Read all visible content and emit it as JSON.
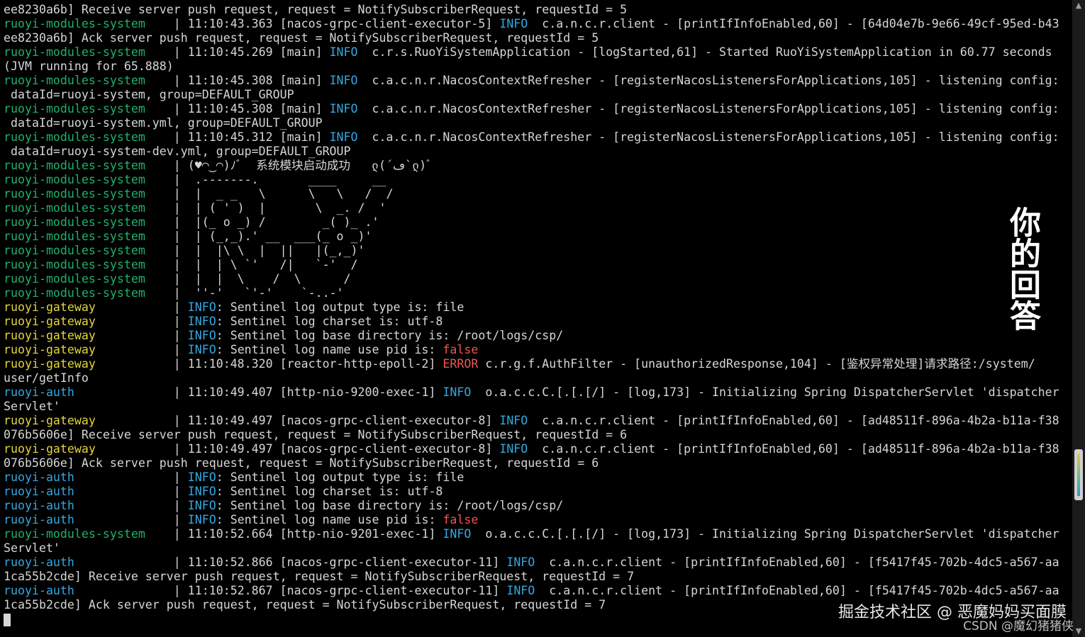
{
  "colors": {
    "background": "#000000",
    "text": "#d6d6d6",
    "service_system": "#1db36a",
    "service_gateway": "#e3d53a",
    "service_auth": "#35a7e0",
    "level_info": "#35a7e0",
    "level_error": "#f05454",
    "keyword_false": "#f05454"
  },
  "terminal": {
    "lines": [
      [
        {
          "t": "ee8230a6b] Receive server push request, request = NotifySubscriberRequest, requestId = 5",
          "c": ""
        }
      ],
      [
        {
          "t": "ruoyi-modules-system",
          "c": "svc-system"
        },
        {
          "t": "    | 11:10:43.363 [nacos-grpc-client-executor-5] ",
          "c": ""
        },
        {
          "t": "INFO",
          "c": "lvl-info"
        },
        {
          "t": "  c.a.n.c.r.client - [printIfInfoEnabled,60] - [64d04e7b-9e66-49cf-95ed-b43",
          "c": ""
        }
      ],
      [
        {
          "t": "ee8230a6b] Ack server push request, request = NotifySubscriberRequest, requestId = 5",
          "c": ""
        }
      ],
      [
        {
          "t": "ruoyi-modules-system",
          "c": "svc-system"
        },
        {
          "t": "    | 11:10:45.269 [main] ",
          "c": ""
        },
        {
          "t": "INFO",
          "c": "lvl-info"
        },
        {
          "t": "  c.r.s.RuoYiSystemApplication - [logStarted,61] - Started RuoYiSystemApplication in 60.77 seconds",
          "c": ""
        }
      ],
      [
        {
          "t": "(JVM running for 65.888)",
          "c": ""
        }
      ],
      [
        {
          "t": "ruoyi-modules-system",
          "c": "svc-system"
        },
        {
          "t": "    | 11:10:45.308 [main] ",
          "c": ""
        },
        {
          "t": "INFO",
          "c": "lvl-info"
        },
        {
          "t": "  c.a.c.n.r.NacosContextRefresher - [registerNacosListenersForApplications,105] - listening config:",
          "c": ""
        }
      ],
      [
        {
          "t": " dataId=ruoyi-system, group=DEFAULT_GROUP",
          "c": ""
        }
      ],
      [
        {
          "t": "ruoyi-modules-system",
          "c": "svc-system"
        },
        {
          "t": "    | 11:10:45.308 [main] ",
          "c": ""
        },
        {
          "t": "INFO",
          "c": "lvl-info"
        },
        {
          "t": "  c.a.c.n.r.NacosContextRefresher - [registerNacosListenersForApplications,105] - listening config:",
          "c": ""
        }
      ],
      [
        {
          "t": " dataId=ruoyi-system.yml, group=DEFAULT_GROUP",
          "c": ""
        }
      ],
      [
        {
          "t": "ruoyi-modules-system",
          "c": "svc-system"
        },
        {
          "t": "    | 11:10:45.312 [main] ",
          "c": ""
        },
        {
          "t": "INFO",
          "c": "lvl-info"
        },
        {
          "t": "  c.a.c.n.r.NacosContextRefresher - [registerNacosListenersForApplications,105] - listening config:",
          "c": ""
        }
      ],
      [
        {
          "t": " dataId=ruoyi-system-dev.yml, group=DEFAULT_GROUP",
          "c": ""
        }
      ],
      [
        {
          "t": "ruoyi-modules-system",
          "c": "svc-system"
        },
        {
          "t": "    | (♥◠‿◠)ﾉﾞ  系统模块启动成功   ლ(´ڡ`ლ)ﾞ",
          "c": ""
        }
      ],
      [
        {
          "t": "ruoyi-modules-system",
          "c": "svc-system"
        },
        {
          "t": "    |  .-------.       ____     __",
          "c": ""
        }
      ],
      [
        {
          "t": "ruoyi-modules-system",
          "c": "svc-system"
        },
        {
          "t": "    |  |  _ _   \\      \\   \\   /  /",
          "c": ""
        }
      ],
      [
        {
          "t": "ruoyi-modules-system",
          "c": "svc-system"
        },
        {
          "t": "    |  | ( ' )  |       \\  _. /  '",
          "c": ""
        }
      ],
      [
        {
          "t": "ruoyi-modules-system",
          "c": "svc-system"
        },
        {
          "t": "    |  |(_ o _) /        _( )_ .'",
          "c": ""
        }
      ],
      [
        {
          "t": "ruoyi-modules-system",
          "c": "svc-system"
        },
        {
          "t": "    |  | (_,_).' __  ___(_ o _)'",
          "c": ""
        }
      ],
      [
        {
          "t": "ruoyi-modules-system",
          "c": "svc-system"
        },
        {
          "t": "    |  |  |\\ \\  |  ||   |(_,_)'",
          "c": ""
        }
      ],
      [
        {
          "t": "ruoyi-modules-system",
          "c": "svc-system"
        },
        {
          "t": "    |  |  | \\ `'   /|   `-'  /",
          "c": ""
        }
      ],
      [
        {
          "t": "ruoyi-modules-system",
          "c": "svc-system"
        },
        {
          "t": "    |  |  |  \\    /  \\      /",
          "c": ""
        }
      ],
      [
        {
          "t": "ruoyi-modules-system",
          "c": "svc-system"
        },
        {
          "t": "    |  ''-'   `'-'    `-..-'",
          "c": ""
        }
      ],
      [
        {
          "t": "ruoyi-gateway",
          "c": "svc-gateway"
        },
        {
          "t": "           | ",
          "c": ""
        },
        {
          "t": "INFO",
          "c": "lvl-info"
        },
        {
          "t": ": Sentinel log output type is: file",
          "c": ""
        }
      ],
      [
        {
          "t": "ruoyi-gateway",
          "c": "svc-gateway"
        },
        {
          "t": "           | ",
          "c": ""
        },
        {
          "t": "INFO",
          "c": "lvl-info"
        },
        {
          "t": ": Sentinel log charset is: utf-8",
          "c": ""
        }
      ],
      [
        {
          "t": "ruoyi-gateway",
          "c": "svc-gateway"
        },
        {
          "t": "           | ",
          "c": ""
        },
        {
          "t": "INFO",
          "c": "lvl-info"
        },
        {
          "t": ": Sentinel log base directory is: /root/logs/csp/",
          "c": ""
        }
      ],
      [
        {
          "t": "ruoyi-gateway",
          "c": "svc-gateway"
        },
        {
          "t": "           | ",
          "c": ""
        },
        {
          "t": "INFO",
          "c": "lvl-info"
        },
        {
          "t": ": Sentinel log name use pid is: ",
          "c": ""
        },
        {
          "t": "false",
          "c": "kw-false"
        }
      ],
      [
        {
          "t": "ruoyi-gateway",
          "c": "svc-gateway"
        },
        {
          "t": "           | 11:10:48.320 [reactor-http-epoll-2] ",
          "c": ""
        },
        {
          "t": "ERROR",
          "c": "lvl-error"
        },
        {
          "t": " c.r.g.f.AuthFilter - [unauthorizedResponse,104] - [鉴权异常处理]请求路径:/system/",
          "c": ""
        }
      ],
      [
        {
          "t": "user/getInfo",
          "c": ""
        }
      ],
      [
        {
          "t": "ruoyi-auth",
          "c": "svc-auth"
        },
        {
          "t": "              | 11:10:49.407 [http-nio-9200-exec-1] ",
          "c": ""
        },
        {
          "t": "INFO",
          "c": "lvl-info"
        },
        {
          "t": "  o.a.c.c.C.[.[.[/] - [log,173] - Initializing Spring DispatcherServlet 'dispatcher",
          "c": ""
        }
      ],
      [
        {
          "t": "Servlet'",
          "c": ""
        }
      ],
      [
        {
          "t": "ruoyi-gateway",
          "c": "svc-gateway"
        },
        {
          "t": "           | 11:10:49.497 [nacos-grpc-client-executor-8] ",
          "c": ""
        },
        {
          "t": "INFO",
          "c": "lvl-info"
        },
        {
          "t": "  c.a.n.c.r.client - [printIfInfoEnabled,60] - [ad48511f-896a-4b2a-b11a-f38",
          "c": ""
        }
      ],
      [
        {
          "t": "076b5606e] Receive server push request, request = NotifySubscriberRequest, requestId = 6",
          "c": ""
        }
      ],
      [
        {
          "t": "ruoyi-gateway",
          "c": "svc-gateway"
        },
        {
          "t": "           | 11:10:49.497 [nacos-grpc-client-executor-8] ",
          "c": ""
        },
        {
          "t": "INFO",
          "c": "lvl-info"
        },
        {
          "t": "  c.a.n.c.r.client - [printIfInfoEnabled,60] - [ad48511f-896a-4b2a-b11a-f38",
          "c": ""
        }
      ],
      [
        {
          "t": "076b5606e] Ack server push request, request = NotifySubscriberRequest, requestId = 6",
          "c": ""
        }
      ],
      [
        {
          "t": "ruoyi-auth",
          "c": "svc-auth"
        },
        {
          "t": "              | ",
          "c": ""
        },
        {
          "t": "INFO",
          "c": "lvl-info"
        },
        {
          "t": ": Sentinel log output type is: file",
          "c": ""
        }
      ],
      [
        {
          "t": "ruoyi-auth",
          "c": "svc-auth"
        },
        {
          "t": "              | ",
          "c": ""
        },
        {
          "t": "INFO",
          "c": "lvl-info"
        },
        {
          "t": ": Sentinel log charset is: utf-8",
          "c": ""
        }
      ],
      [
        {
          "t": "ruoyi-auth",
          "c": "svc-auth"
        },
        {
          "t": "              | ",
          "c": ""
        },
        {
          "t": "INFO",
          "c": "lvl-info"
        },
        {
          "t": ": Sentinel log base directory is: /root/logs/csp/",
          "c": ""
        }
      ],
      [
        {
          "t": "ruoyi-auth",
          "c": "svc-auth"
        },
        {
          "t": "              | ",
          "c": ""
        },
        {
          "t": "INFO",
          "c": "lvl-info"
        },
        {
          "t": ": Sentinel log name use pid is: ",
          "c": ""
        },
        {
          "t": "false",
          "c": "kw-false"
        }
      ],
      [
        {
          "t": "ruoyi-modules-system",
          "c": "svc-system"
        },
        {
          "t": "    | 11:10:52.664 [http-nio-9201-exec-1] ",
          "c": ""
        },
        {
          "t": "INFO",
          "c": "lvl-info"
        },
        {
          "t": "  o.a.c.c.C.[.[.[/] - [log,173] - Initializing Spring DispatcherServlet 'dispatcher",
          "c": ""
        }
      ],
      [
        {
          "t": "Servlet'",
          "c": ""
        }
      ],
      [
        {
          "t": "ruoyi-auth",
          "c": "svc-auth"
        },
        {
          "t": "              | 11:10:52.866 [nacos-grpc-client-executor-11] ",
          "c": ""
        },
        {
          "t": "INFO",
          "c": "lvl-info"
        },
        {
          "t": "  c.a.n.c.r.client - [printIfInfoEnabled,60] - [f5417f45-702b-4dc5-a567-aa",
          "c": ""
        }
      ],
      [
        {
          "t": "1ca55b2cde] Receive server push request, request = NotifySubscriberRequest, requestId = 7",
          "c": ""
        }
      ],
      [
        {
          "t": "ruoyi-auth",
          "c": "svc-auth"
        },
        {
          "t": "              | 11:10:52.867 [nacos-grpc-client-executor-11] ",
          "c": ""
        },
        {
          "t": "INFO",
          "c": "lvl-info"
        },
        {
          "t": "  c.a.n.c.r.client - [printIfInfoEnabled,60] - [f5417f45-702b-4dc5-a567-aa",
          "c": ""
        }
      ],
      [
        {
          "t": "1ca55b2cde] Ack server push request, request = NotifySubscriberRequest, requestId = 7",
          "c": ""
        }
      ]
    ]
  },
  "scrollbar": {
    "up_icon": "▲",
    "down_icon": "▼",
    "position": 0.78
  },
  "overlay": {
    "side_text": "你的回答",
    "watermark_main": "掘金技术社区 @ 恶魔妈妈买面膜",
    "watermark_sub": "CSDN @魔幻猪猪侠"
  }
}
